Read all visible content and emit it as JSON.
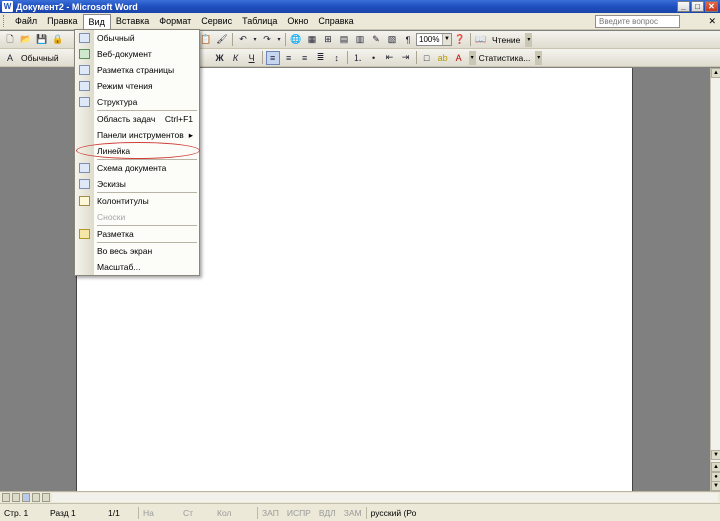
{
  "window": {
    "title": "Документ2 - Microsoft Word",
    "minimize": "_",
    "maximize": "□",
    "close": "✕"
  },
  "menubar": {
    "items": [
      "Файл",
      "Правка",
      "Вид",
      "Вставка",
      "Формат",
      "Сервис",
      "Таблица",
      "Окно",
      "Справка"
    ],
    "active": "Вид",
    "ask_placeholder": "Введите вопрос",
    "close_doc": "✕"
  },
  "toolbar_standard": {
    "zoom": "100%",
    "reading_label": "Чтение"
  },
  "toolbar_formatting": {
    "style": "Обычный",
    "bold": "Ж",
    "italic": "К",
    "underline": "Ч",
    "statistics": "Статистика..."
  },
  "view_menu": {
    "items": [
      {
        "label": "Обычный",
        "icon": "normal-view-icon"
      },
      {
        "label": "Веб-документ",
        "icon": "web-layout-icon"
      },
      {
        "label": "Разметка страницы",
        "icon": "print-layout-icon"
      },
      {
        "label": "Режим чтения",
        "icon": "reading-layout-icon"
      },
      {
        "label": "Структура",
        "icon": "outline-icon"
      },
      {
        "label": "Область задач",
        "shortcut": "Ctrl+F1"
      },
      {
        "label": "Панели инструментов",
        "submenu": "▸"
      },
      {
        "label": "Линейка"
      },
      {
        "label": "Схема документа",
        "icon": "document-map-icon"
      },
      {
        "label": "Эскизы",
        "icon": "thumbnails-icon"
      },
      {
        "label": "Колонтитулы",
        "icon": "header-footer-icon"
      },
      {
        "label": "Сноски",
        "disabled": true
      },
      {
        "label": "Разметка",
        "icon": "markup-icon"
      },
      {
        "label": "Во весь экран"
      },
      {
        "label": "Масштаб..."
      }
    ]
  },
  "statusbar": {
    "page": "Стр. 1",
    "section": "Разд 1",
    "pages": "1/1",
    "at": "На",
    "line": "Ст",
    "col": "Кол",
    "rec": "ЗАП",
    "trk": "ИСПР",
    "ext": "ВДЛ",
    "ovr": "ЗАМ",
    "lang": "русский (Ро"
  }
}
